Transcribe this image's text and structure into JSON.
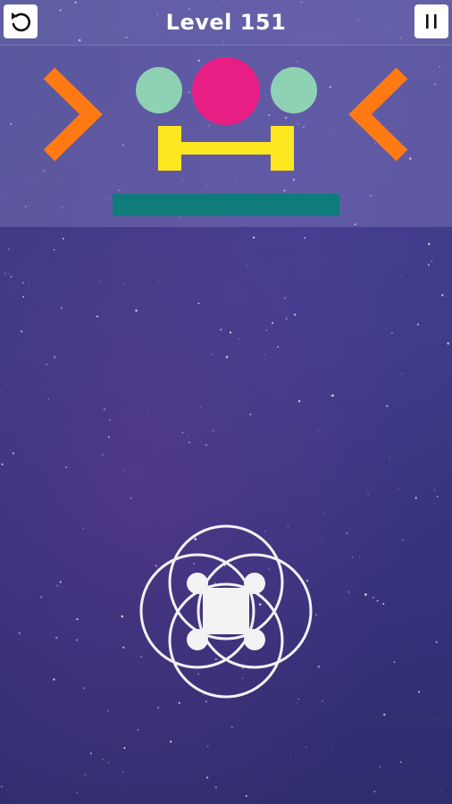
{
  "header": {
    "level_title": "Level 151"
  },
  "icons": {
    "undo": "undo-icon",
    "pause": "pause-icon"
  },
  "colors": {
    "chevron": "#ff7a12",
    "small_circle": "#8ed1b3",
    "big_circle": "#e91e84",
    "bracket": "#ffe822",
    "bar": "#0f7b7b",
    "player": "#f2f2f2"
  }
}
